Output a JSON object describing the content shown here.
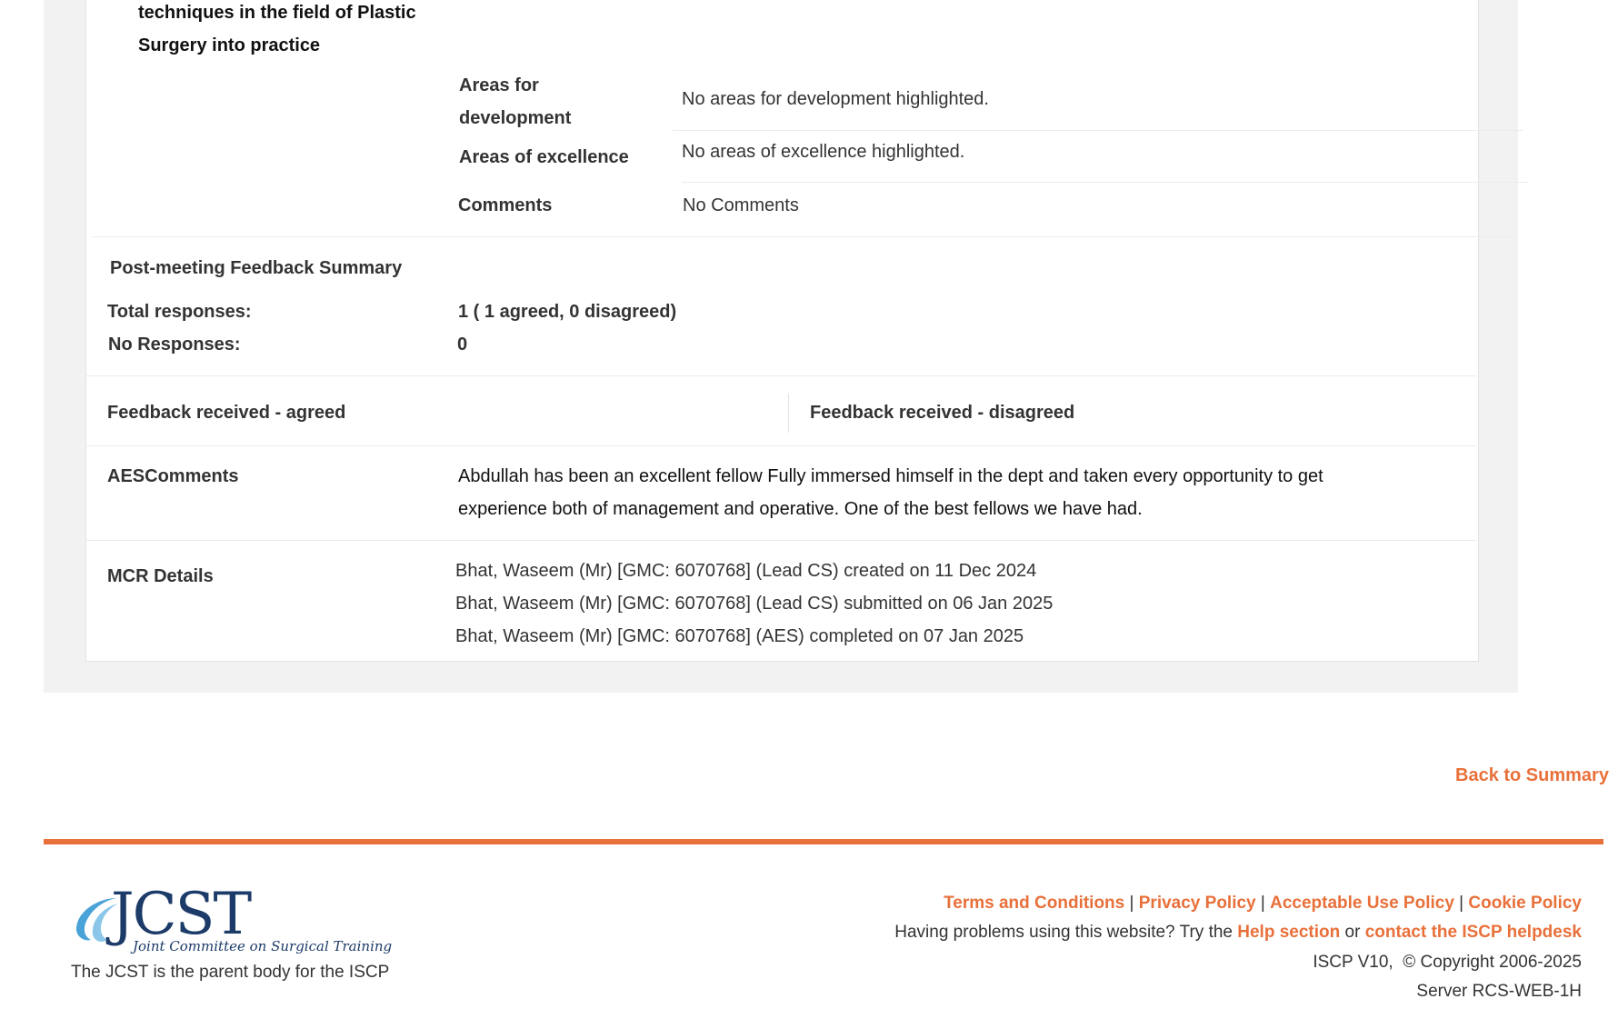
{
  "competency": {
    "title_line1": "techniques in the field of Plastic",
    "title_line2": "Surgery into practice"
  },
  "details": {
    "areas_for_development_label_1": "Areas for",
    "areas_for_development_label_2": "development",
    "areas_for_development_value": "No areas for development highlighted.",
    "areas_of_excellence_label": "Areas of excellence",
    "areas_of_excellence_value": "No areas of excellence highlighted.",
    "comments_label": "Comments",
    "comments_value": "No Comments"
  },
  "feedback_summary": {
    "heading": "Post-meeting Feedback Summary",
    "total_label": "Total responses:",
    "total_value": "1 ( 1 agreed, 0 disagreed)",
    "no_responses_label": "No Responses:",
    "no_responses_value": "0"
  },
  "feedback_received": {
    "agreed_label": "Feedback received - agreed",
    "disagreed_label": "Feedback received - disagreed"
  },
  "aes_comments": {
    "label": "AESComments",
    "line1": "Abdullah has been an excellent fellow Fully immersed himself in the dept and taken every opportunity to get",
    "line2": "experience both of management and operative. One of the best fellows we have had."
  },
  "mcr_details": {
    "label": "MCR Details",
    "entries": [
      "Bhat, Waseem (Mr) [GMC: 6070768] (Lead CS) created on 11 Dec 2024",
      "Bhat, Waseem (Mr) [GMC: 6070768] (Lead CS) submitted on 06 Jan 2025",
      "Bhat, Waseem (Mr) [GMC: 6070768] (AES) completed on 07 Jan 2025"
    ]
  },
  "back_link": "Back to Summary",
  "footer": {
    "logo_text": "JCST",
    "logo_subtitle": "Joint Committee on Surgical Training",
    "parent_body": "The JCST is the parent body for the ISCP",
    "links": {
      "terms": "Terms and Conditions",
      "privacy": "Privacy Policy",
      "acceptable_use": "Acceptable Use Policy",
      "cookie": "Cookie Policy",
      "separator": "|"
    },
    "help_prefix": "Having problems using this website? Try the",
    "help_link": "Help section",
    "help_or": "or",
    "helpdesk_link": "contact the ISCP helpdesk",
    "version": "ISCP V10,  © Copyright 2006-2025",
    "server": "Server RCS-WEB-1H"
  },
  "colors": {
    "accent": "#e8703a",
    "panel_bg": "#f2f2f2",
    "logo_blue": "#1c3b68"
  }
}
